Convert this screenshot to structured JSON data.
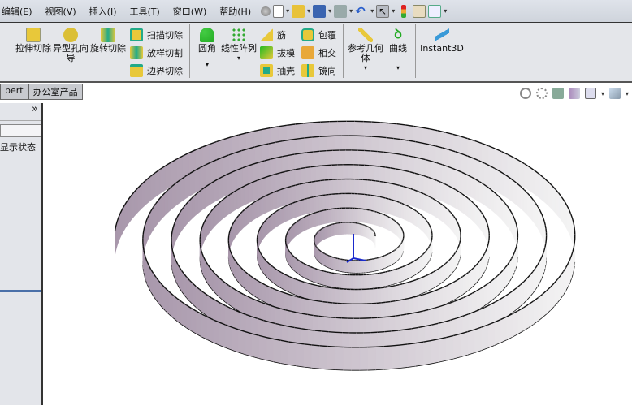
{
  "menubar": {
    "items": [
      "编辑(E)",
      "视图(V)",
      "插入(I)",
      "工具(T)",
      "窗口(W)",
      "帮助(H)"
    ],
    "toolbar_icons": [
      "pin-icon",
      "new-document-icon",
      "open-icon",
      "save-icon",
      "print-icon",
      "undo-icon",
      "select-icon",
      "traffic-light-icon",
      "options-icon",
      "checklist-icon"
    ]
  },
  "ribbon": {
    "big1": [
      {
        "label": "拉伸切除",
        "icon": "extruded-cut-icon"
      },
      {
        "label": "异型孔向导",
        "icon": "hole-wizard-icon"
      },
      {
        "label": "旋转切除",
        "icon": "revolved-cut-icon"
      }
    ],
    "cuts": [
      {
        "label": "扫描切除",
        "icon": "swept-cut-icon"
      },
      {
        "label": "放样切割",
        "icon": "lofted-cut-icon"
      },
      {
        "label": "边界切除",
        "icon": "boundary-cut-icon"
      }
    ],
    "big2": [
      {
        "label": "圆角",
        "icon": "fillet-icon"
      },
      {
        "label": "线性阵列",
        "icon": "linear-pattern-icon"
      }
    ],
    "features1": [
      {
        "label": "筋",
        "icon": "rib-icon"
      },
      {
        "label": "拔模",
        "icon": "draft-icon"
      },
      {
        "label": "抽壳",
        "icon": "shell-icon"
      }
    ],
    "features2": [
      {
        "label": "包覆",
        "icon": "wrap-icon"
      },
      {
        "label": "相交",
        "icon": "intersect-icon"
      },
      {
        "label": "镜向",
        "icon": "mirror-icon"
      }
    ],
    "big3": [
      {
        "label": "参考几何体",
        "icon": "reference-geometry-icon"
      },
      {
        "label": "曲线",
        "icon": "curves-icon"
      }
    ],
    "instant3d": "Instant3D"
  },
  "tabs": [
    "pert",
    "办公室产品"
  ],
  "panel": {
    "expand": "»",
    "display_state": "显示状态"
  },
  "viewport": {
    "colors": {
      "wall_light": "#f4f4f4",
      "wall_purple": "#a897ab"
    }
  }
}
